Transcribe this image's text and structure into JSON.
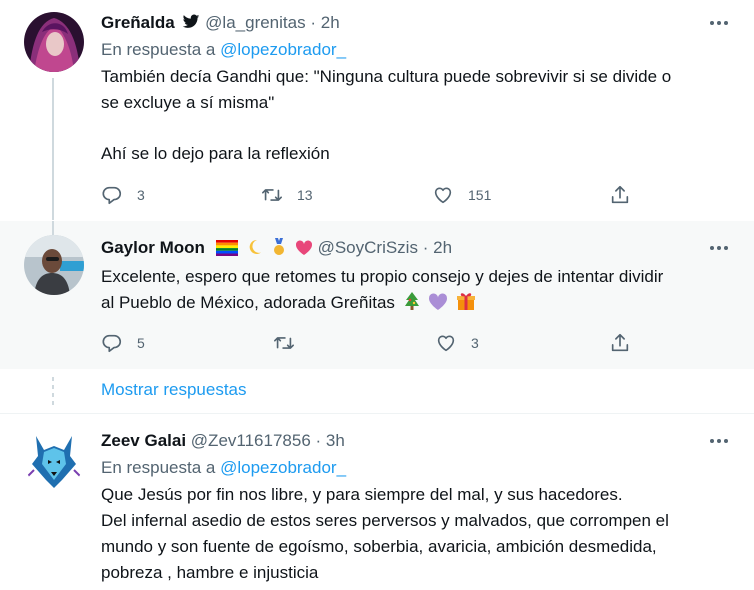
{
  "tweets": [
    {
      "name": "Greñalda",
      "handle": "@la_grenitas",
      "separator": "·",
      "time": "2h",
      "reply_prefix": "En respuesta a",
      "reply_to": "@lopezobrador_",
      "text_lines": [
        "También decía Gandhi que: \"Ninguna cultura puede sobrevivir si se divide o",
        "se excluye a sí misma\"",
        "",
        "Ahí se lo dejo para la reflexión"
      ],
      "replies": "3",
      "retweets": "13",
      "likes": "151"
    },
    {
      "name": "Gaylor Moon",
      "handle": "@SoyCriSzis",
      "separator": "·",
      "time": "2h",
      "text_lines": [
        "Excelente, espero que retomes tu propio consejo y dejes de intentar dividir",
        "al Pueblo de México, adorada Greñitas"
      ],
      "replies": "5",
      "retweets": "",
      "likes": "3"
    },
    {
      "name": "Zeev Galai",
      "handle": "@Zev11617856",
      "separator": "·",
      "time": "3h",
      "reply_prefix": "En respuesta a",
      "reply_to": "@lopezobrador_",
      "text_lines": [
        "Que Jesús por fin nos libre, y  para siempre del mal,  y sus hacedores.",
        "Del infernal asedio de estos seres perversos y malvados, que corrompen el",
        "mundo y son fuente de egoísmo, soberbia, avaricia, ambición desmedida,",
        "pobreza , hambre e injusticia"
      ]
    }
  ],
  "show_replies_label": "Mostrar respuestas",
  "icons": {
    "verified": "twitter-bird-icon",
    "more": "more-horizontal-icon",
    "reply": "reply-icon",
    "retweet": "retweet-icon",
    "like": "heart-icon",
    "share": "share-icon"
  },
  "colors": {
    "accent": "#1d9bf0",
    "secondary_text": "#536471",
    "hover_bg": "#f7f9f9"
  }
}
